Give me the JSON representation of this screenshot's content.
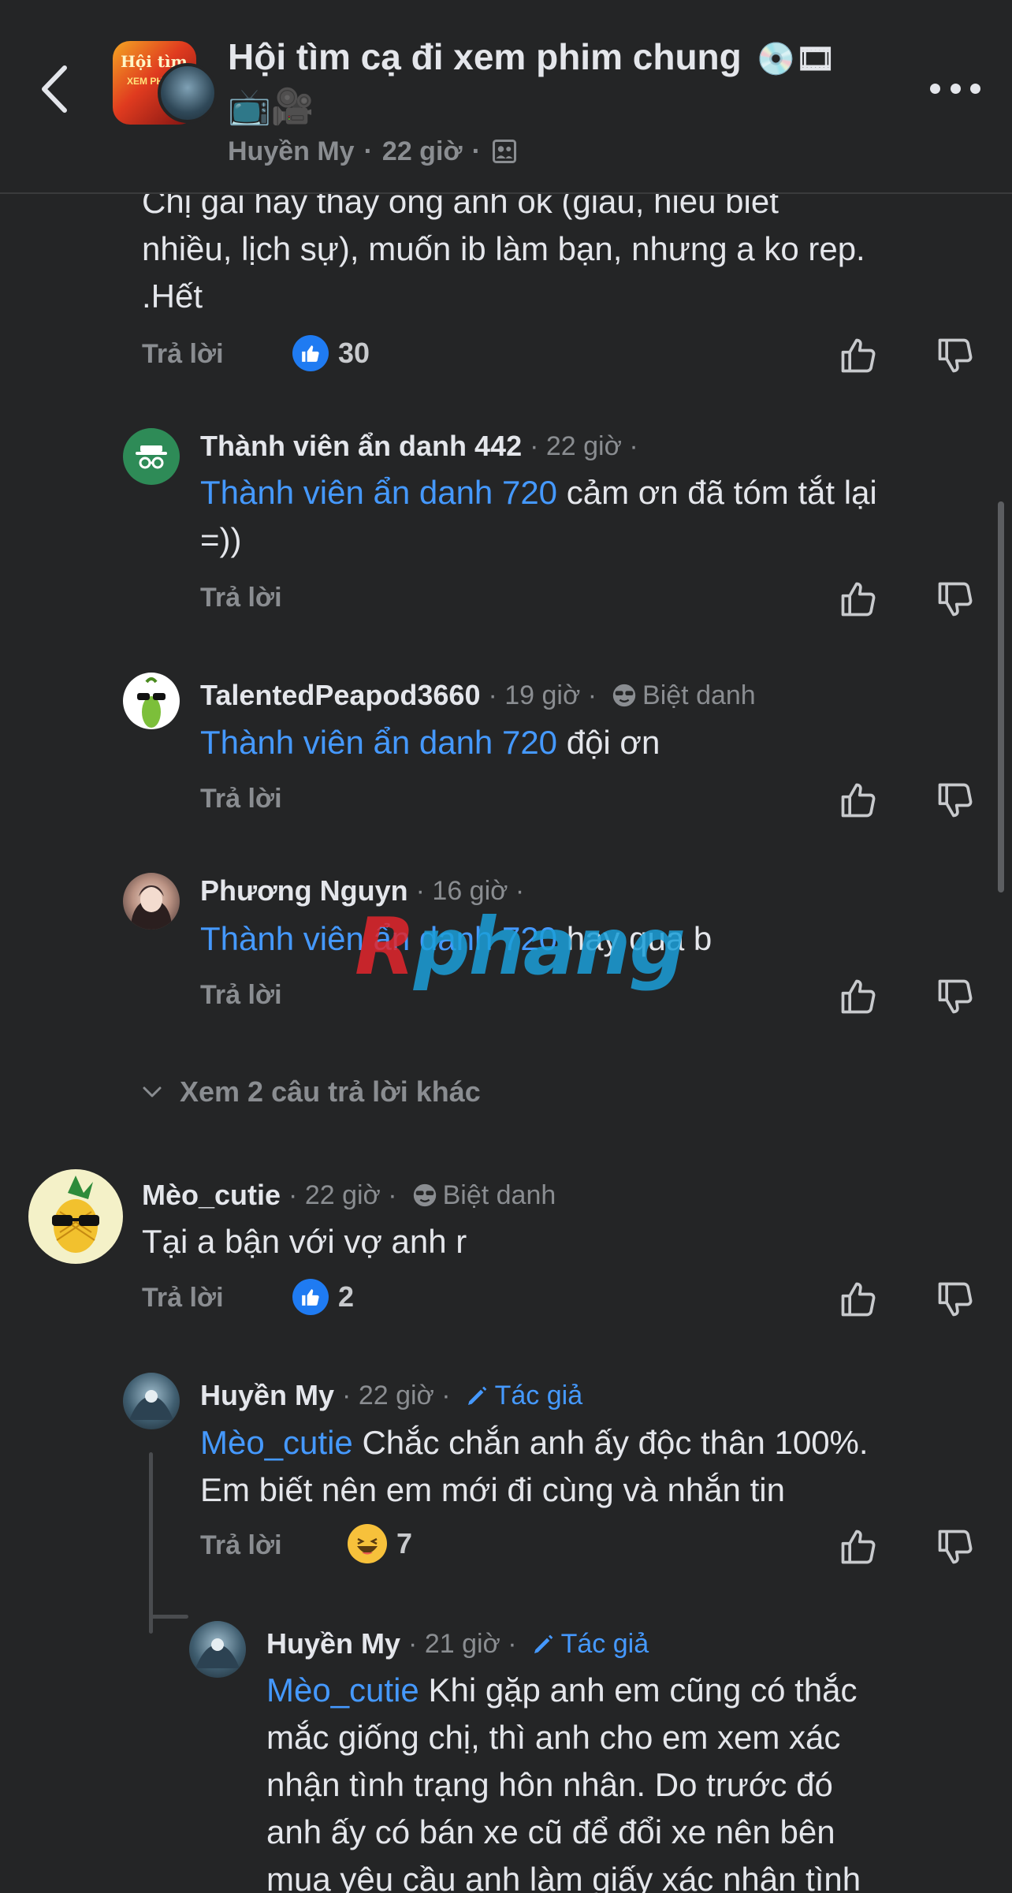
{
  "header": {
    "title": "Hội tìm cạ đi xem phim chung",
    "title_emojis": "💿🎞",
    "title_emojis_line2": "📺🎥",
    "author": "Huyền My",
    "time": "22 giờ",
    "group_avatar_text": "Hội tìm",
    "group_avatar_sub": "XEM PHIM C"
  },
  "first_comment": {
    "text_line1": "Chị gái hay thấy ông anh ok (giàu, hiểu biết",
    "text_line2": "nhiều, lịch sự), muốn ib làm bạn, nhưng a ko rep.",
    "text_line3": ".Hết",
    "reply": "Trả lời",
    "reaction_count": "30"
  },
  "comments": [
    {
      "name": "Thành viên ẩn danh 442",
      "meta": "· 22 giờ ·",
      "mention": "Thành viên ẩn danh 720",
      "text": " cảm ơn đã tóm tắt lại",
      "text_line2": "=))",
      "reply": "Trả lời"
    },
    {
      "name": "TalentedPeapod3660",
      "meta": "· 19 giờ ·",
      "tag": "Biệt danh",
      "mention": "Thành viên ẩn danh 720",
      "text": " đội ơn",
      "reply": "Trả lời"
    },
    {
      "name": "Phương Nguyn",
      "meta": "· 16 giờ ·",
      "mention": "Thành viên ẩn danh 720",
      "text": " hay qua b",
      "reply": "Trả lời"
    }
  ],
  "more_replies": "Xem 2 câu trả lời khác",
  "meo_comment": {
    "name": "Mèo_cutie",
    "meta": "· 22 giờ ·",
    "tag": "Biệt danh",
    "text": "Tại a bận với vợ anh r",
    "reply": "Trả lời",
    "reaction_count": "2"
  },
  "huyen_reply1": {
    "name": "Huyền My",
    "meta": "· 22 giờ ·",
    "tag": "Tác giả",
    "mention": "Mèo_cutie",
    "text": " Chắc chắn anh ấy độc thân 100%.",
    "text_line2": "Em biết nên em mới đi cùng và nhắn tin",
    "reply": "Trả lời",
    "reaction_count": "7"
  },
  "huyen_reply2": {
    "name": "Huyền My",
    "meta": "· 21 giờ ·",
    "tag": "Tác giả",
    "mention": "Mèo_cutie",
    "text": " Khi gặp anh em cũng có thắc",
    "text_line2": "mắc giống chị, thì anh cho em xem xác",
    "text_line3": "nhận tình trạng hôn nhân. Do trước đó",
    "text_line4": "anh ấy có bán xe cũ để đổi xe nên bên",
    "text_line5": "mua yêu cầu anh làm giấy xác nhận tình"
  },
  "watermark": {
    "part1": "R",
    "part2": "phang"
  },
  "colors": {
    "background": "#242526",
    "mention": "#4599ff",
    "like": "#1f7bf2",
    "muted": "#8a8d91"
  }
}
